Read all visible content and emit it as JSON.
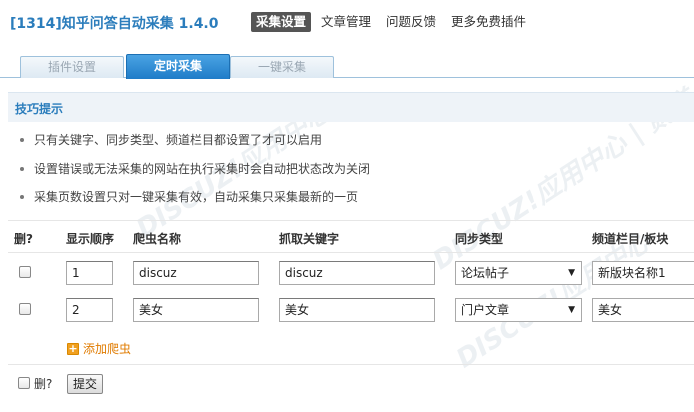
{
  "app": {
    "title": "[1314]知乎问答自动采集 1.4.0"
  },
  "topnav": [
    {
      "label": "采集设置",
      "active": true
    },
    {
      "label": "文章管理",
      "active": false
    },
    {
      "label": "问题反馈",
      "active": false
    },
    {
      "label": "更多免费插件",
      "active": false
    }
  ],
  "tabs": [
    {
      "label": "插件设置",
      "active": false
    },
    {
      "label": "定时采集",
      "active": true
    },
    {
      "label": "一键采集",
      "active": false
    }
  ],
  "tips": {
    "title": "技巧提示",
    "items": [
      "只有关键字、同步类型、频道栏目都设置了才可以启用",
      "设置错误或无法采集的网站在执行采集时会自动把状态改为关闭",
      "采集页数设置只对一键采集有效，自动采集只采集最新的一页"
    ]
  },
  "table": {
    "headers": {
      "delete": "删?",
      "order": "显示顺序",
      "name": "爬虫名称",
      "keyword": "抓取关键字",
      "sync_type": "同步类型",
      "channel": "频道栏目/板块"
    },
    "rows": [
      {
        "order": "1",
        "name": "discuz",
        "keyword": "discuz",
        "sync_type": "论坛帖子",
        "channel": "新版块名称1"
      },
      {
        "order": "2",
        "name": "美女",
        "keyword": "美女",
        "sync_type": "门户文章",
        "channel": "美女"
      }
    ]
  },
  "add_crawler_label": "添加爬虫",
  "footer": {
    "delete_label": "删?",
    "submit_label": "提交"
  },
  "colors": {
    "accent": "#2b7dbc",
    "tab_active": "#1f7cc8",
    "add_link": "#e07b00"
  },
  "icons": {
    "add": "plus-square-icon",
    "dropdown": "chevron-down-icon"
  }
}
